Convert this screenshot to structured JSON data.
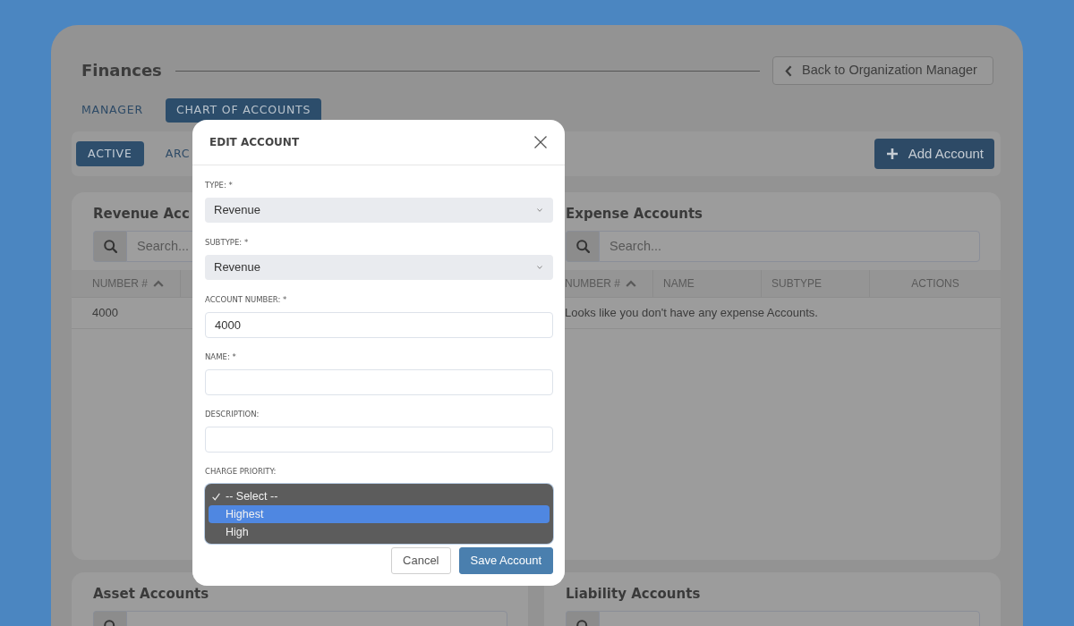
{
  "page": {
    "title": "Finances",
    "back_button": "Back to Organization Manager"
  },
  "tabs": [
    {
      "label": "MANAGER",
      "selected": false
    },
    {
      "label": "CHART OF ACCOUNTS",
      "selected": true
    }
  ],
  "filters": [
    {
      "label": "ACTIVE",
      "selected": true
    },
    {
      "label": "ARC",
      "selected": false
    }
  ],
  "add_button": "Add Account",
  "panels": [
    {
      "title": "Revenue Acc",
      "search_placeholder": "Search...",
      "columns": [
        {
          "label": "NUMBER #",
          "sorted": true
        }
      ],
      "rows": [
        [
          "4000"
        ]
      ]
    },
    {
      "title": "Expense Accounts",
      "search_placeholder": "Search...",
      "columns": [
        {
          "label": "NUMBER #",
          "sorted": true
        },
        {
          "label": "NAME",
          "sorted": false
        },
        {
          "label": "SUBTYPE",
          "sorted": false
        },
        {
          "label": "ACTIONS",
          "sorted": false
        }
      ],
      "empty_message": "Looks like you don't have any expense Accounts."
    },
    {
      "title": "Asset Accounts"
    },
    {
      "title": "Liability Accounts"
    }
  ],
  "modal": {
    "title": "EDIT ACCOUNT",
    "fields": [
      {
        "kind": "select",
        "label": "TYPE: *",
        "value": "Revenue"
      },
      {
        "kind": "select",
        "label": "SUBTYPE: *",
        "value": "Revenue"
      },
      {
        "kind": "text",
        "label": "ACCOUNT NUMBER: *",
        "value": "4000"
      },
      {
        "kind": "text",
        "label": "NAME: *"
      },
      {
        "kind": "text",
        "label": "DESCRIPTION:"
      },
      {
        "kind": "dropdown",
        "label": "CHARGE PRIORITY:",
        "options": [
          {
            "label": "-- Select --",
            "selected": true,
            "highlighted": false
          },
          {
            "label": "Highest",
            "selected": false,
            "highlighted": true
          },
          {
            "label": "High",
            "selected": false,
            "highlighted": false
          }
        ]
      }
    ],
    "buttons": [
      {
        "label": "Cancel",
        "kind": "secondary"
      },
      {
        "label": "Save Account",
        "kind": "primary"
      }
    ]
  }
}
